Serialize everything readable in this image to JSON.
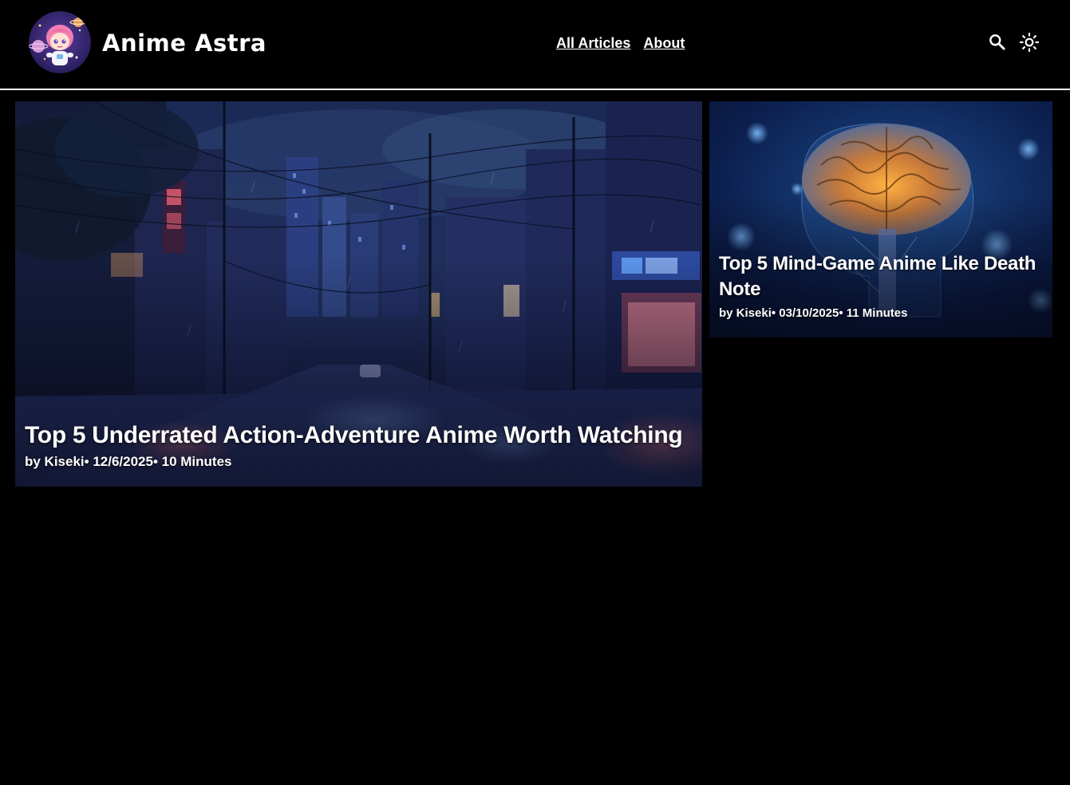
{
  "header": {
    "site_title": "Anime Astra",
    "logo_icon": "astronaut-girl-logo",
    "nav": [
      {
        "label": "All Articles"
      },
      {
        "label": "About"
      }
    ],
    "search_icon": "search-icon",
    "theme_icon": "sun-icon"
  },
  "articles": [
    {
      "title": "Top 5 Underrated Action-Adventure Anime Worth Watching",
      "meta": "by Kiseki• 12/6/2025• 10 Minutes",
      "image": "night-city-street-rain"
    },
    {
      "title": "Top 5 Mind-Game Anime Like Death Note",
      "meta": "by Kiseki• 03/10/2025• 11 Minutes",
      "image": "glowing-brain"
    }
  ],
  "colors": {
    "background": "#000000",
    "text": "#ffffff",
    "divider": "#ffffff"
  }
}
